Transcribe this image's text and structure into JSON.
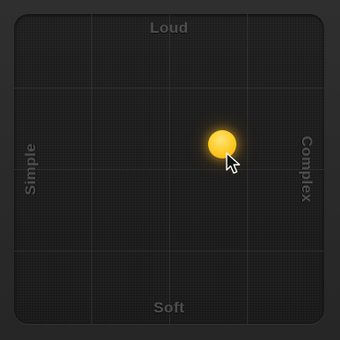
{
  "axes": {
    "top": "Loud",
    "bottom": "Soft",
    "left": "Simple",
    "right": "Complex"
  },
  "puck": {
    "complexity": 0.67,
    "loudness": 0.58,
    "color": "#ffcf2e"
  },
  "icons": {
    "cursor": "arrow-cursor-icon"
  }
}
